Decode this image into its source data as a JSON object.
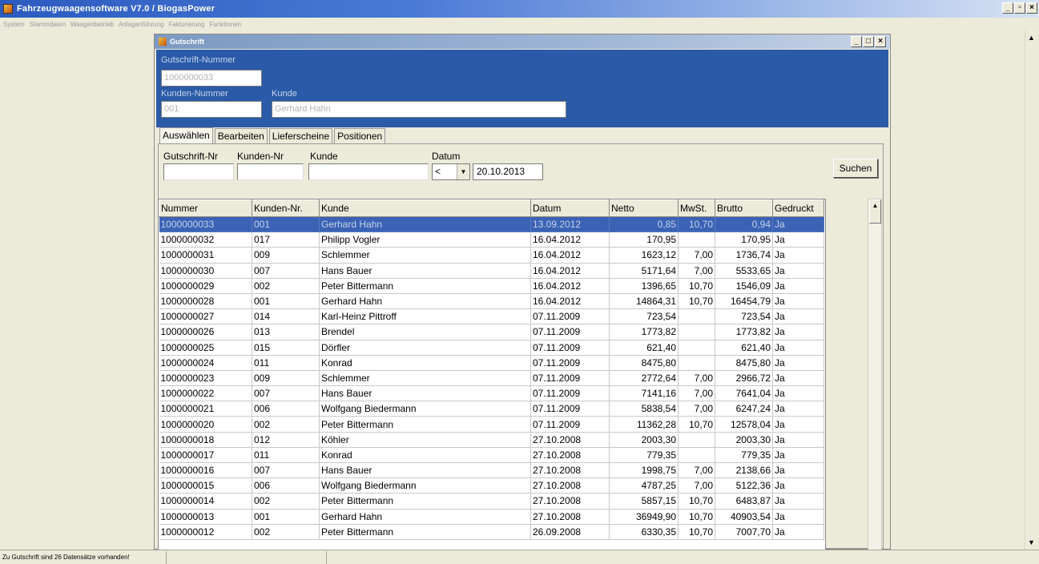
{
  "app": {
    "title": "Fahrzeugwaagensoftware V7.0 / BiogasPower",
    "menu": [
      "System",
      "Stammdaten",
      "Waagenbetrieb",
      "Anlagenführung",
      "Fakturierung",
      "Funktionen"
    ]
  },
  "window": {
    "title": "Gutschrift",
    "min": "_",
    "max": "□",
    "close": "×"
  },
  "app_buttons": {
    "min": "_",
    "restore": "▫",
    "close": "×"
  },
  "header": {
    "gutschrift_label": "Gutschrift-Nummer",
    "gutschrift_value": "1000000033",
    "kunden_nr_label": "Kunden-Nummer",
    "kunden_nr_value": "001",
    "kunde_label": "Kunde",
    "kunde_value": "Gerhard Hahn"
  },
  "tabs": [
    "Auswählen",
    "Bearbeiten",
    "Lieferscheine",
    "Positionen"
  ],
  "filter": {
    "gutschrift_label": "Gutschrift-Nr",
    "kunden_label": "Kunden-Nr",
    "kunde_label": "Kunde",
    "datum_label": "Datum",
    "operator": "<",
    "date": "20.10.2013",
    "search_button": "Suchen"
  },
  "table": {
    "columns": [
      "Nummer",
      "Kunden-Nr.",
      "Kunde",
      "Datum",
      "Netto",
      "MwSt.",
      "Brutto",
      "Gedruckt"
    ],
    "rows": [
      [
        "1000000033",
        "001",
        "Gerhard Hahn",
        "13.09.2012",
        "0,85",
        "10,70",
        "0,94",
        "Ja"
      ],
      [
        "1000000032",
        "017",
        "Philipp Vogler",
        "16.04.2012",
        "170,95",
        "",
        "170,95",
        "Ja"
      ],
      [
        "1000000031",
        "009",
        "Schlemmer",
        "16.04.2012",
        "1623,12",
        "7,00",
        "1736,74",
        "Ja"
      ],
      [
        "1000000030",
        "007",
        "Hans Bauer",
        "16.04.2012",
        "5171,64",
        "7,00",
        "5533,65",
        "Ja"
      ],
      [
        "1000000029",
        "002",
        "Peter Bittermann",
        "16.04.2012",
        "1396,65",
        "10,70",
        "1546,09",
        "Ja"
      ],
      [
        "1000000028",
        "001",
        "Gerhard Hahn",
        "16.04.2012",
        "14864,31",
        "10,70",
        "16454,79",
        "Ja"
      ],
      [
        "1000000027",
        "014",
        "Karl-Heinz Pittroff",
        "07.11.2009",
        "723,54",
        "",
        "723,54",
        "Ja"
      ],
      [
        "1000000026",
        "013",
        "Brendel",
        "07.11.2009",
        "1773,82",
        "",
        "1773,82",
        "Ja"
      ],
      [
        "1000000025",
        "015",
        "Dörfler",
        "07.11.2009",
        "621,40",
        "",
        "621,40",
        "Ja"
      ],
      [
        "1000000024",
        "011",
        "Konrad",
        "07.11.2009",
        "8475,80",
        "",
        "8475,80",
        "Ja"
      ],
      [
        "1000000023",
        "009",
        "Schlemmer",
        "07.11.2009",
        "2772,64",
        "7,00",
        "2966,72",
        "Ja"
      ],
      [
        "1000000022",
        "007",
        "Hans Bauer",
        "07.11.2009",
        "7141,16",
        "7,00",
        "7641,04",
        "Ja"
      ],
      [
        "1000000021",
        "006",
        "Wolfgang Biedermann",
        "07.11.2009",
        "5838,54",
        "7,00",
        "6247,24",
        "Ja"
      ],
      [
        "1000000020",
        "002",
        "Peter Bittermann",
        "07.11.2009",
        "11362,28",
        "10,70",
        "12578,04",
        "Ja"
      ],
      [
        "1000000018",
        "012",
        "Köhler",
        "27.10.2008",
        "2003,30",
        "",
        "2003,30",
        "Ja"
      ],
      [
        "1000000017",
        "011",
        "Konrad",
        "27.10.2008",
        "779,35",
        "",
        "779,35",
        "Ja"
      ],
      [
        "1000000016",
        "007",
        "Hans Bauer",
        "27.10.2008",
        "1998,75",
        "7,00",
        "2138,66",
        "Ja"
      ],
      [
        "1000000015",
        "006",
        "Wolfgang Biedermann",
        "27.10.2008",
        "4787,25",
        "7,00",
        "5122,36",
        "Ja"
      ],
      [
        "1000000014",
        "002",
        "Peter Bittermann",
        "27.10.2008",
        "5857,15",
        "10,70",
        "6483,87",
        "Ja"
      ],
      [
        "1000000013",
        "001",
        "Gerhard Hahn",
        "27.10.2008",
        "36949,90",
        "10,70",
        "40903,54",
        "Ja"
      ],
      [
        "1000000012",
        "002",
        "Peter Bittermann",
        "26.09.2008",
        "6330,35",
        "10,70",
        "7007,70",
        "Ja"
      ]
    ],
    "selected_row": 0
  },
  "status": {
    "text": "Zu Gutschrift sind 26 Datensätze vorhanden!"
  },
  "icons": {
    "scroll_up": "▲",
    "scroll_down": "▼",
    "dropdown": "▼"
  }
}
